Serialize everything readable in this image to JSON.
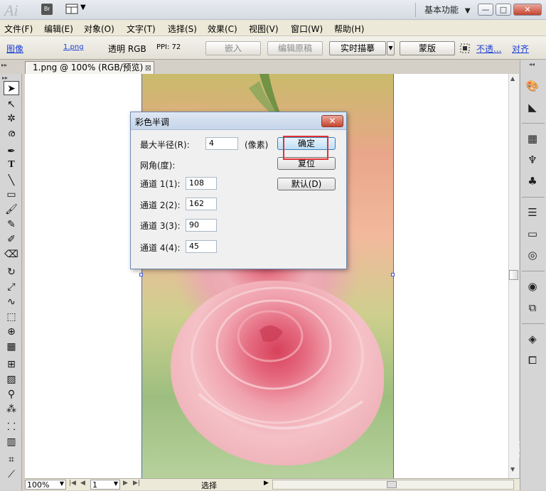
{
  "titlebar": {
    "app_logo": "Ai",
    "bridge_label": "Br",
    "layout_arrow": "▼",
    "workspace_label": "基本功能",
    "workspace_arrow": "▼",
    "minimize": "—",
    "restore": "□",
    "close": "✕"
  },
  "menubar": {
    "items": [
      "文件(F)",
      "编辑(E)",
      "对象(O)",
      "文字(T)",
      "选择(S)",
      "效果(C)",
      "视图(V)",
      "窗口(W)",
      "帮助(H)"
    ]
  },
  "controlbar": {
    "image_label": "图像",
    "file_link": "1.png",
    "mode_label": "透明 RGB",
    "ppi_label": "PPI: 72",
    "embed_button": "嵌入",
    "edit_original_button": "编辑原稿",
    "live_trace_button": "实时描摹",
    "mask_button": "蒙版",
    "opacity_link": "不透...",
    "align_link": "对齐"
  },
  "document": {
    "tab_title": "1.png @ 100% (RGB/预览)",
    "tab_close": "⊠"
  },
  "dialog": {
    "title": "彩色半调",
    "close": "✕",
    "max_radius_label": "最大半径(R):",
    "max_radius_value": "4",
    "unit_label": "(像素)",
    "screen_angles_label": "网角(度):",
    "channels": [
      {
        "label": "通道 1(1):",
        "value": "108"
      },
      {
        "label": "通道 2(2):",
        "value": "162"
      },
      {
        "label": "通道 3(3):",
        "value": "90"
      },
      {
        "label": "通道 4(4):",
        "value": "45"
      }
    ],
    "ok_button": "确定",
    "reset_button": "复位",
    "default_button": "默认(D)"
  },
  "statusbar": {
    "zoom": "100%",
    "page": "1",
    "status_text": "选择"
  },
  "watermark": {
    "text": "Bai du 经验",
    "url": "jingyan.baidu.com"
  },
  "colors": {
    "highlight": "#e23131",
    "link": "#1b3fd6",
    "artboard_border": "#4d67d6"
  }
}
